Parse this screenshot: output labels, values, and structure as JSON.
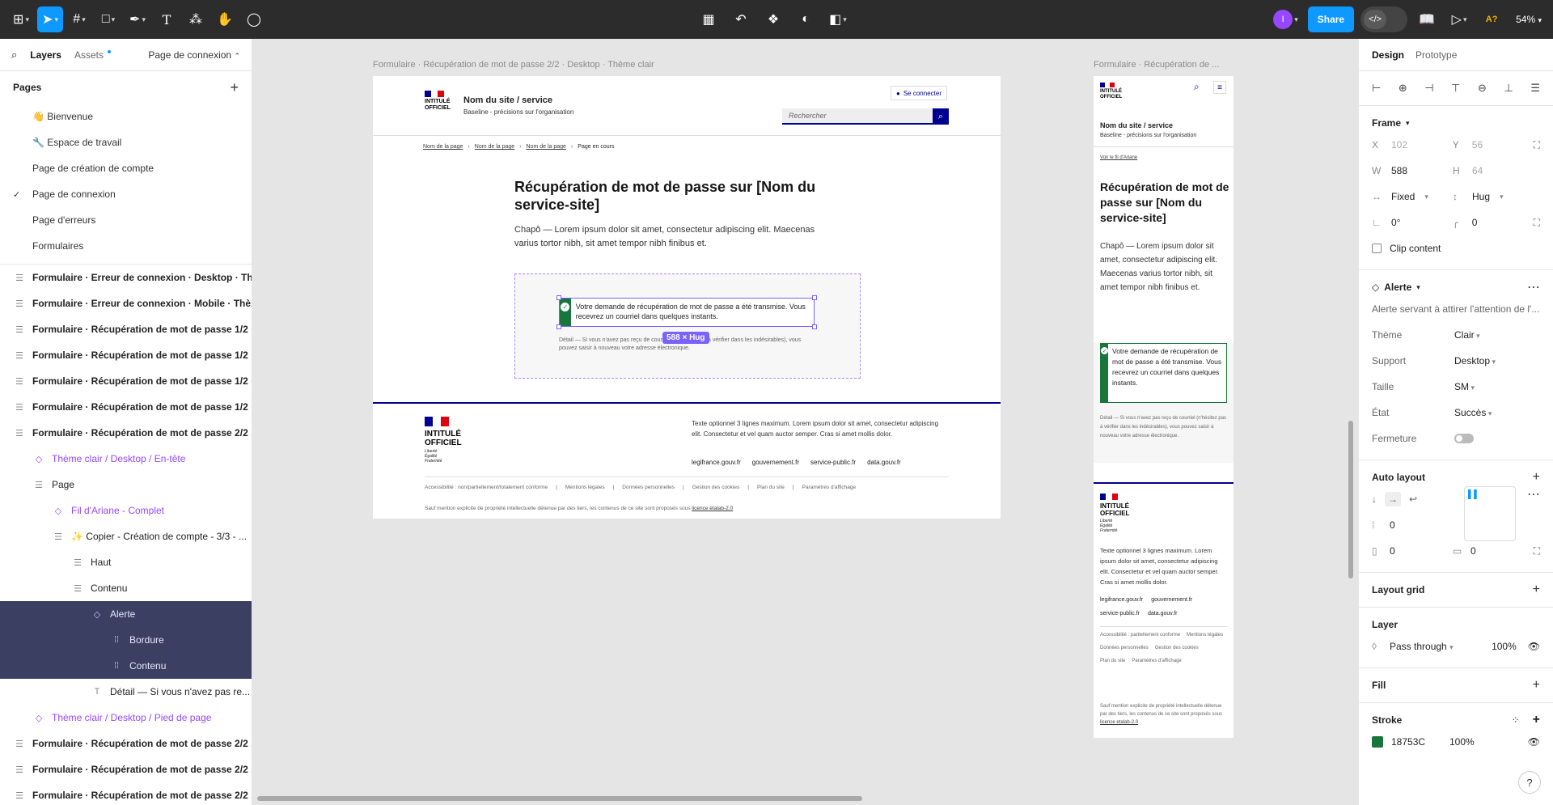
{
  "toolbar": {
    "zoom": "54%",
    "share_label": "Share",
    "avatar_initial": "I",
    "a11y_label": "A?"
  },
  "left_panel": {
    "tabs": {
      "layers": "Layers",
      "assets": "Assets"
    },
    "current_page": "Page de connexion",
    "pages_title": "Pages",
    "pages": [
      "👋 Bienvenue",
      "🔧 Espace de travail",
      "Page de création de compte",
      "Page de connexion",
      "Page d'erreurs",
      "Formulaires"
    ],
    "layers": [
      "Formulaire · Erreur de connexion · Desktop · Th...",
      "Formulaire · Erreur de connexion · Mobile · Thè...",
      "Formulaire · Récupération de mot de passe 1/2 ·...",
      "Formulaire · Récupération de mot de passe 1/2 ·...",
      "Formulaire · Récupération de mot de passe 1/2 ·...",
      "Formulaire · Récupération de mot de passe 1/2 ·...",
      "Formulaire · Récupération de mot de passe 2/2 ...",
      "Thème clair / Desktop / En-tête",
      "Page",
      "Fil d'Ariane - Complet",
      "✨ Copier - Création de compte - 3/3 - ...",
      "Haut",
      "Contenu",
      "Alerte",
      "Bordure",
      "Contenu",
      "Détail — Si vous n'avez pas re...",
      "Thème clair / Desktop / Pied de page",
      "Formulaire · Récupération de mot de passe 2/2 ...",
      "Formulaire · Récupération de mot de passe 2/2 ...",
      "Formulaire · Récupération de mot de passe 2/2 ..."
    ]
  },
  "canvas": {
    "desktop_label": "Formulaire · Récupération de mot de passe 2/2 · Desktop · Thème clair",
    "mobile_label": "Formulaire · Récupération de ...",
    "logo_lines": [
      "INTITULÉ",
      "OFFICIEL"
    ],
    "logo_motto": [
      "Liberté",
      "Égalité",
      "Fraternité"
    ],
    "site_name": "Nom du site / service",
    "site_baseline": "Baseline - précisions sur l'organisation",
    "login_label": "Se connecter",
    "search_placeholder": "Rechercher",
    "breadcrumb": [
      "Nom de la page",
      "Nom de la page",
      "Nom de la page",
      "Page en cours"
    ],
    "breadcrumb_mobile": "Voir le fil d'Ariane",
    "title": "Récupération de mot de passe sur [Nom du service-site]",
    "chapo": "Chapô — Lorem ipsum dolor sit amet, consectetur adipiscing elit. Maecenas varius tortor nibh, sit amet tempor nibh finibus et.",
    "alert_text": "Votre demande de récupération de mot de passe a été transmise. Vous recevrez un courriel dans quelques instants.",
    "detail_text": "Détail — Si vous n'avez pas reçu de courriel (n'hésitez pas à vérifier dans les indésirables), vous pouvez saisir à nouveau votre adresse électronique.",
    "size_badge": "588 × Hug",
    "footer_text": "Texte optionnel 3 lignes maximum. Lorem ipsum dolor sit amet, consectetur adipiscing elit. Consectetur et vel quam auctor semper. Cras si amet mollis dolor.",
    "footer_links": [
      "legifrance.gouv.fr",
      "gouvernement.fr",
      "service-public.fr",
      "data.gouv.fr"
    ],
    "footer_bottom": [
      "Accessibilité : non/partiellement/totalement conforme",
      "Mentions légales",
      "Données personnelles",
      "Gestion des cookies",
      "Plan du site",
      "Paramètres d'affichage"
    ],
    "footer_bottom_mobile": [
      "Accessibilité : partiellement conforme",
      "Mentions légales",
      "Données personnelles",
      "Gestion des cookies",
      "Plan du site",
      "Paramètres d'affichage"
    ],
    "footer_license_prefix": "Sauf mention explicite de propriété intellectuelle détenue par des tiers, les contenus de ce site sont proposés sous",
    "footer_license_link": "licence etalab-2.0"
  },
  "right_panel": {
    "tabs": {
      "design": "Design",
      "prototype": "Prototype"
    },
    "frame_title": "Frame",
    "x": "102",
    "y": "56",
    "w": "588",
    "h": "64",
    "width_mode": "Fixed",
    "height_mode": "Hug",
    "rotation": "0°",
    "radius": "0",
    "clip_content": "Clip content",
    "component_name": "Alerte",
    "component_desc": "Alerte servant à attirer l'attention de l'...",
    "props": [
      {
        "label": "Thème",
        "value": "Clair"
      },
      {
        "label": "Support",
        "value": "Desktop"
      },
      {
        "label": "Taille",
        "value": "SM"
      },
      {
        "label": "État",
        "value": "Succès"
      }
    ],
    "closing_label": "Fermeture",
    "auto_layout_title": "Auto layout",
    "gap": "0",
    "pad_h": "0",
    "pad_v": "0",
    "layout_grid_title": "Layout grid",
    "layer_title": "Layer",
    "blend_mode": "Pass through",
    "opacity": "100%",
    "fill_title": "Fill",
    "stroke_title": "Stroke",
    "stroke_hex": "18753C",
    "stroke_opacity": "100%",
    "stroke_color": "#18753c"
  },
  "colors": {
    "accent": "#0d99ff",
    "component": "#9747ff",
    "dsfr_blue": "#000091",
    "success": "#18753c"
  }
}
